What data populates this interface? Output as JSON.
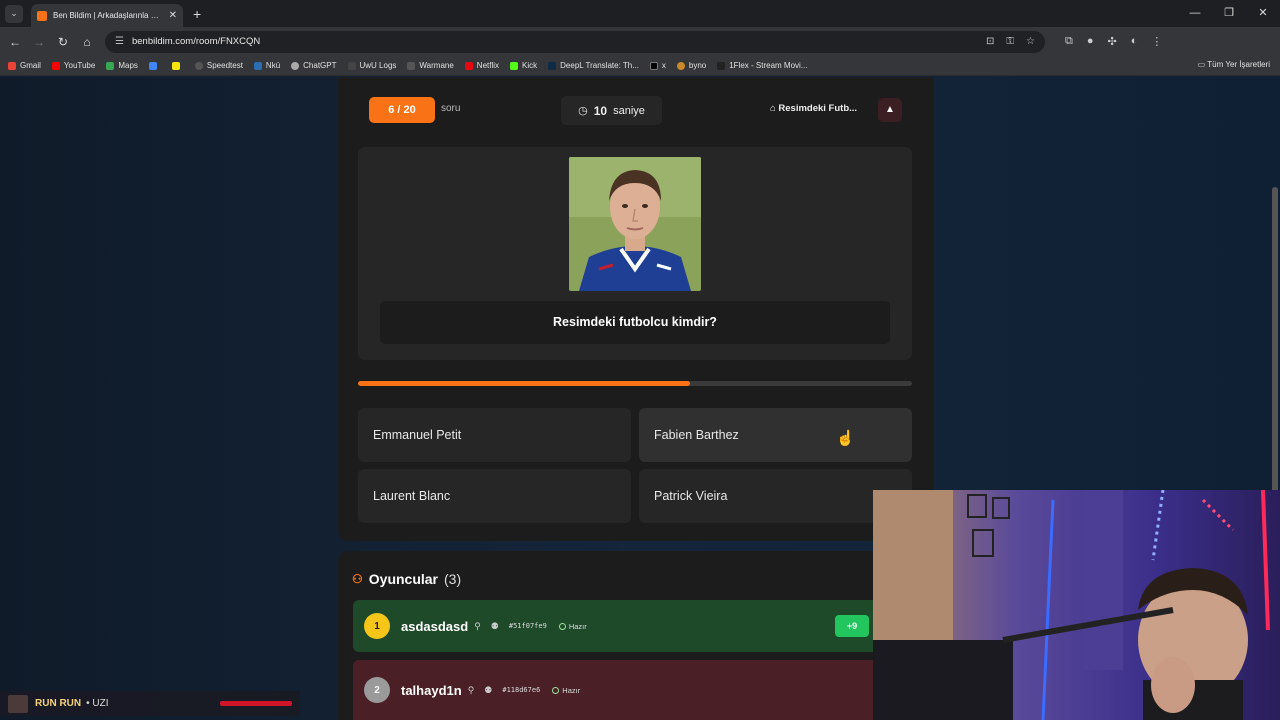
{
  "browser": {
    "tab_title": "Ben Bildim | Arkadaşlarınla Onli...",
    "url": "benbildim.com/room/FNXCQN",
    "bookmarks": [
      "Gmail",
      "YouTube",
      "Maps",
      "",
      "",
      "Speedtest",
      "Nkü",
      "ChatGPT",
      "UwU Logs",
      "Warmane",
      "Netflix",
      "Kick",
      "DeepL Translate: Th...",
      "x",
      "byno",
      "1Flex - Stream Movi..."
    ],
    "bookmarks_right": "Tüm Yer İşaretleri"
  },
  "quiz": {
    "question_counter": "6 / 20",
    "counter_suffix": "soru",
    "timer_value": "10",
    "timer_unit": "saniye",
    "category": "Resimdeki Futb...",
    "question": "Resimdeki futbolcu kimdir?",
    "progress_fraction": 0.6,
    "answers": [
      "Emmanuel Petit",
      "Fabien Barthez",
      "Laurent Blanc",
      "Patrick Vieira"
    ]
  },
  "players": {
    "title": "Oyuncular",
    "count": "(3)",
    "list": [
      {
        "rank": "1",
        "name": "asdasdasd",
        "id": "#51f07fe9",
        "status": "Hazır",
        "score": "+9"
      },
      {
        "rank": "2",
        "name": "talhayd1n",
        "id": "#118d67e6",
        "status": "Hazır",
        "score": ""
      }
    ]
  },
  "spotify": {
    "song": "RUN RUN",
    "artist": "UZI"
  },
  "colors": {
    "accent": "#f97316",
    "background": "#132335",
    "panel": "#1c1c1c",
    "row_winner": "#1e4a2a",
    "row_other": "#4a1f25"
  }
}
